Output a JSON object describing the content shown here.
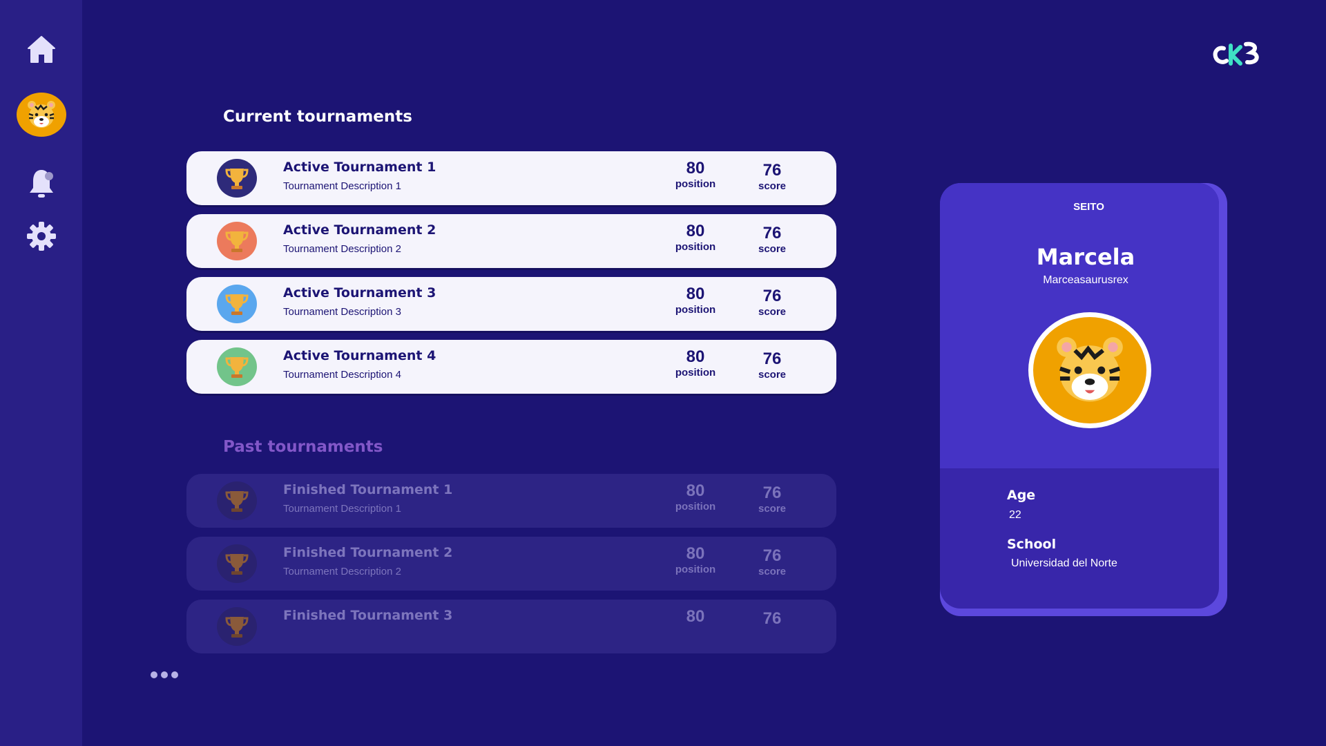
{
  "sidebar": {
    "items": [
      {
        "name": "home",
        "icon": "home-icon"
      },
      {
        "name": "profile",
        "icon": "tiger-avatar-icon"
      },
      {
        "name": "notifications",
        "icon": "bell-icon"
      },
      {
        "name": "settings",
        "icon": "gear-icon"
      }
    ]
  },
  "logo": {
    "icon": "ckb-logo"
  },
  "current": {
    "title": "Current tournaments",
    "rows": [
      {
        "name": "Active Tournament 1",
        "description": "Tournament Description 1",
        "position": "80",
        "position_label": "position",
        "score": "76",
        "score_label": "score",
        "trophy_color": "#2e2a7a"
      },
      {
        "name": "Active Tournament 2",
        "description": "Tournament Description 2",
        "position": "80",
        "position_label": "position",
        "score": "76",
        "score_label": "score",
        "trophy_color": "#ec7a5c"
      },
      {
        "name": "Active Tournament 3",
        "description": "Tournament Description 3",
        "position": "80",
        "position_label": "position",
        "score": "76",
        "score_label": "score",
        "trophy_color": "#5aa7ee"
      },
      {
        "name": "Active Tournament 4",
        "description": "Tournament Description 4",
        "position": "80",
        "position_label": "position",
        "score": "76",
        "score_label": "score",
        "trophy_color": "#72c48a"
      }
    ]
  },
  "past": {
    "title": "Past tournaments",
    "rows": [
      {
        "name": "Finished Tournament 1",
        "description": "Tournament Description 1",
        "position": "80",
        "position_label": "position",
        "score": "76",
        "score_label": "score"
      },
      {
        "name": "Finished Tournament 2",
        "description": "Tournament Description 2",
        "position": "80",
        "position_label": "position",
        "score": "76",
        "score_label": "score"
      },
      {
        "name": "Finished Tournament 3",
        "description": "",
        "position": "80",
        "position_label": "",
        "score": "76",
        "score_label": ""
      }
    ]
  },
  "profile": {
    "rank": "SEITO",
    "name": "Marcela",
    "handle": "Marceasaurusrex",
    "avatar": "tiger-avatar-icon",
    "age_label": "Age",
    "age": "22",
    "school_label": "School",
    "school": "Universidad del Norte"
  },
  "colors": {
    "background": "#1c1474",
    "sidebar": "#291f86",
    "card": "#4533c5",
    "avatar_orange": "#f0a100"
  }
}
